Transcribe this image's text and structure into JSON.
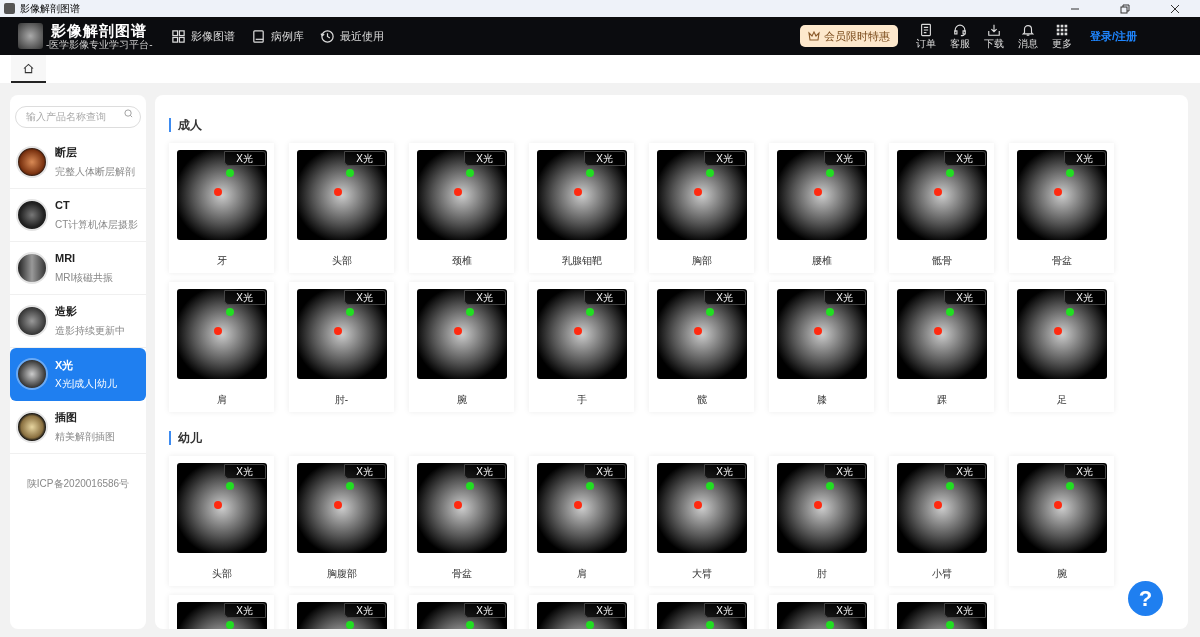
{
  "window": {
    "title": "影像解剖图谱"
  },
  "nav": {
    "logo_title": "影像解剖图谱",
    "logo_subtitle": "-医学影像专业学习平台-",
    "items": [
      {
        "label": "影像图谱"
      },
      {
        "label": "病例库"
      },
      {
        "label": "最近使用"
      }
    ],
    "promo": "会员限时特惠",
    "tools": [
      {
        "label": "订单"
      },
      {
        "label": "客服"
      },
      {
        "label": "下载"
      },
      {
        "label": "消息"
      },
      {
        "label": "更多"
      }
    ],
    "login": "登录/注册"
  },
  "sidebar": {
    "search": {
      "placeholder": "输入产品名称查询"
    },
    "items": [
      {
        "title": "断层",
        "subtitle": "完整人体断层解剖",
        "selected": false
      },
      {
        "title": "CT",
        "subtitle": "CT计算机体层摄影",
        "selected": false
      },
      {
        "title": "MRI",
        "subtitle": "MRI核磁共振",
        "selected": false
      },
      {
        "title": "造影",
        "subtitle": "造影持续更新中",
        "selected": false
      },
      {
        "title": "X光",
        "subtitle": "X光|成人|幼儿",
        "selected": true
      },
      {
        "title": "插图",
        "subtitle": "精美解剖插图",
        "selected": false
      }
    ],
    "footer": "陕ICP备2020016586号"
  },
  "sections": [
    {
      "title": "成人",
      "cards": [
        {
          "label": "牙",
          "badge": "X光"
        },
        {
          "label": "头部",
          "badge": "X光"
        },
        {
          "label": "颈椎",
          "badge": "X光"
        },
        {
          "label": "乳腺钼靶",
          "badge": "X光"
        },
        {
          "label": "胸部",
          "badge": "X光"
        },
        {
          "label": "腰椎",
          "badge": "X光"
        },
        {
          "label": "骶骨",
          "badge": "X光"
        },
        {
          "label": "骨盆",
          "badge": "X光"
        },
        {
          "label": "肩",
          "badge": "X光"
        },
        {
          "label": "肘-",
          "badge": "X光"
        },
        {
          "label": "腕",
          "badge": "X光"
        },
        {
          "label": "手",
          "badge": "X光"
        },
        {
          "label": "髋",
          "badge": "X光"
        },
        {
          "label": "膝",
          "badge": "X光"
        },
        {
          "label": "踝",
          "badge": "X光"
        },
        {
          "label": "足",
          "badge": "X光"
        }
      ]
    },
    {
      "title": "幼儿",
      "cards": [
        {
          "label": "头部",
          "badge": "X光"
        },
        {
          "label": "胸腹部",
          "badge": "X光"
        },
        {
          "label": "骨盆",
          "badge": "X光"
        },
        {
          "label": "肩",
          "badge": "X光"
        },
        {
          "label": "大臂",
          "badge": "X光"
        },
        {
          "label": "肘",
          "badge": "X光"
        },
        {
          "label": "小臂",
          "badge": "X光"
        },
        {
          "label": "腕",
          "badge": "X光"
        },
        {
          "badge": "X光"
        },
        {
          "badge": "X光"
        },
        {
          "badge": "X光"
        },
        {
          "badge": "X光"
        },
        {
          "badge": "X光"
        },
        {
          "badge": "X光"
        },
        {
          "badge": "X光"
        }
      ]
    }
  ],
  "help_button": "?"
}
